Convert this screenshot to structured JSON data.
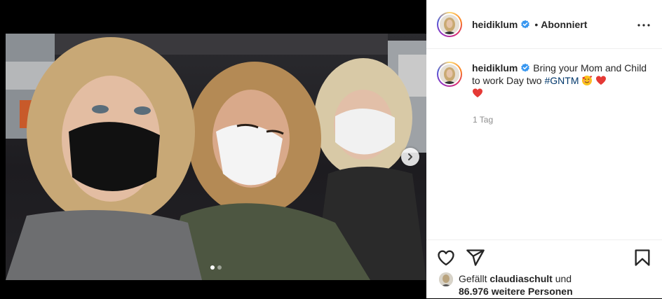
{
  "post": {
    "username": "heidiklum",
    "separator": "•",
    "follow_state": "Abonniert",
    "caption_text": "Bring your Mom and Child to work Day two",
    "hashtag": "#GNTM",
    "time_ago": "1 Tag"
  },
  "likes": {
    "prefix": "Gefällt",
    "user": "claudiaschult",
    "joiner": "und",
    "count_text": "86.976 weitere Personen"
  },
  "carousel": {
    "current": 1,
    "total": 2
  },
  "colors": {
    "verified_blue": "#3897f0",
    "hashtag": "#00376b",
    "muted": "#8e8e8e",
    "heart_red": "#ed1c24"
  },
  "icons": [
    "verified-badge-icon",
    "more-options-icon",
    "heart-icon",
    "share-icon",
    "bookmark-icon",
    "chevron-right-icon",
    "smiling-face-hearts-emoji",
    "red-heart-emoji"
  ]
}
